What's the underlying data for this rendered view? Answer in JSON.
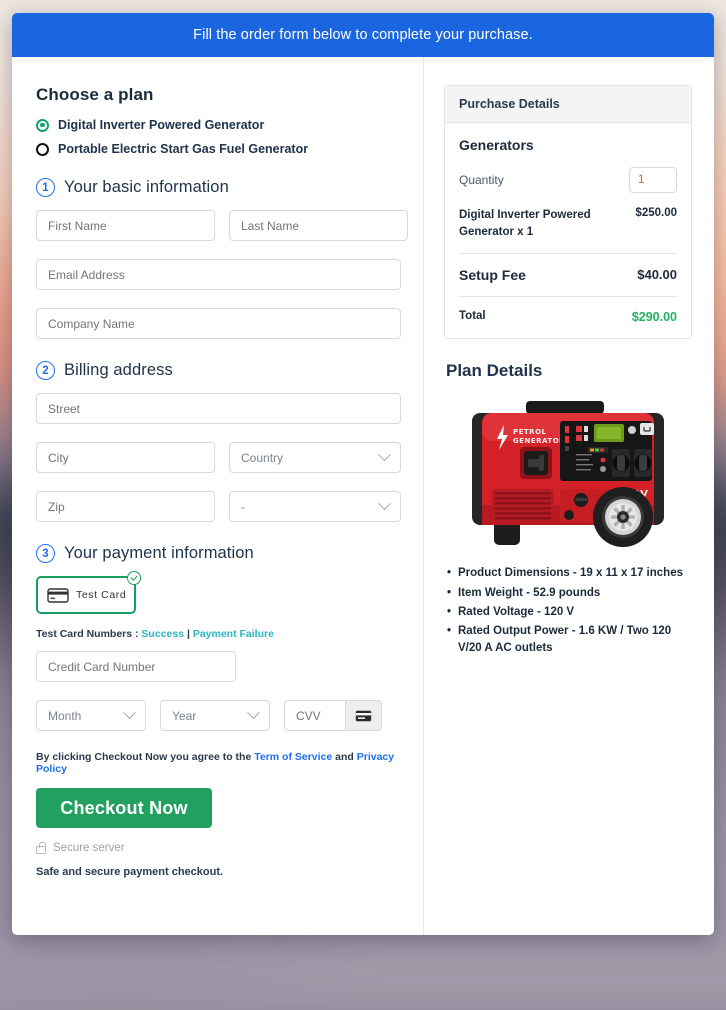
{
  "banner": {
    "text": "Fill the order form below to complete your purchase."
  },
  "plan": {
    "heading": "Choose a plan",
    "options": [
      {
        "label": "Digital Inverter Powered Generator",
        "selected": true
      },
      {
        "label": "Portable Electric Start Gas Fuel Generator",
        "selected": false
      }
    ]
  },
  "steps": {
    "basic": {
      "number": "1",
      "title": "Your basic information"
    },
    "billing": {
      "number": "2",
      "title": "Billing address"
    },
    "payment": {
      "number": "3",
      "title": "Your payment information"
    }
  },
  "fields": {
    "first_name": "First Name",
    "last_name": "Last Name",
    "email": "Email Address",
    "company": "Company Name",
    "street": "Street",
    "city": "City",
    "country": "Country",
    "zip": "Zip",
    "state": "-",
    "card_number": "Credit Card Number",
    "month": "Month",
    "year": "Year",
    "cvv": "CVV"
  },
  "payment": {
    "card_tile_label": "Test  Card",
    "test_prefix": "Test Card Numbers : ",
    "success_link": "Success",
    "separator": " | ",
    "failure_link": "Payment Failure"
  },
  "terms": {
    "prefix": "By clicking Checkout Now you agree to the ",
    "tos_link": "Term of Service",
    "conjunction": " and ",
    "privacy_link": "Privacy Policy"
  },
  "checkout": {
    "button_label": "Checkout Now",
    "secure_label": "Secure server",
    "safe_label": "Safe and secure payment checkout."
  },
  "purchase": {
    "panel_title": "Purchase Details",
    "group_title": "Generators",
    "quantity_label": "Quantity",
    "quantity_value": "1",
    "line_item_name": "Digital Inverter Powered Generator x 1",
    "line_item_amount": "$250.00",
    "setup_fee_label": "Setup Fee",
    "setup_fee_amount": "$40.00",
    "total_label": "Total",
    "total_amount": "$290.00"
  },
  "plan_details": {
    "heading": "Plan Details",
    "product_image": {
      "brand_line1": "PETROL",
      "brand_line2": "GENERATOR",
      "voltage_label": "220V"
    },
    "specs": [
      "Product Dimensions - 19 x 11 x 17 inches",
      "Item Weight - 52.9 pounds",
      "Rated Voltage - 120 V",
      "Rated Output Power - 1.6 KW / Two 120 V/20 A AC outlets"
    ]
  },
  "colors": {
    "banner_blue": "#1a66e0",
    "accent_blue": "#1d6ff2",
    "green": "#22a060",
    "total_green": "#22b361",
    "link_teal": "#2ab6c4"
  }
}
